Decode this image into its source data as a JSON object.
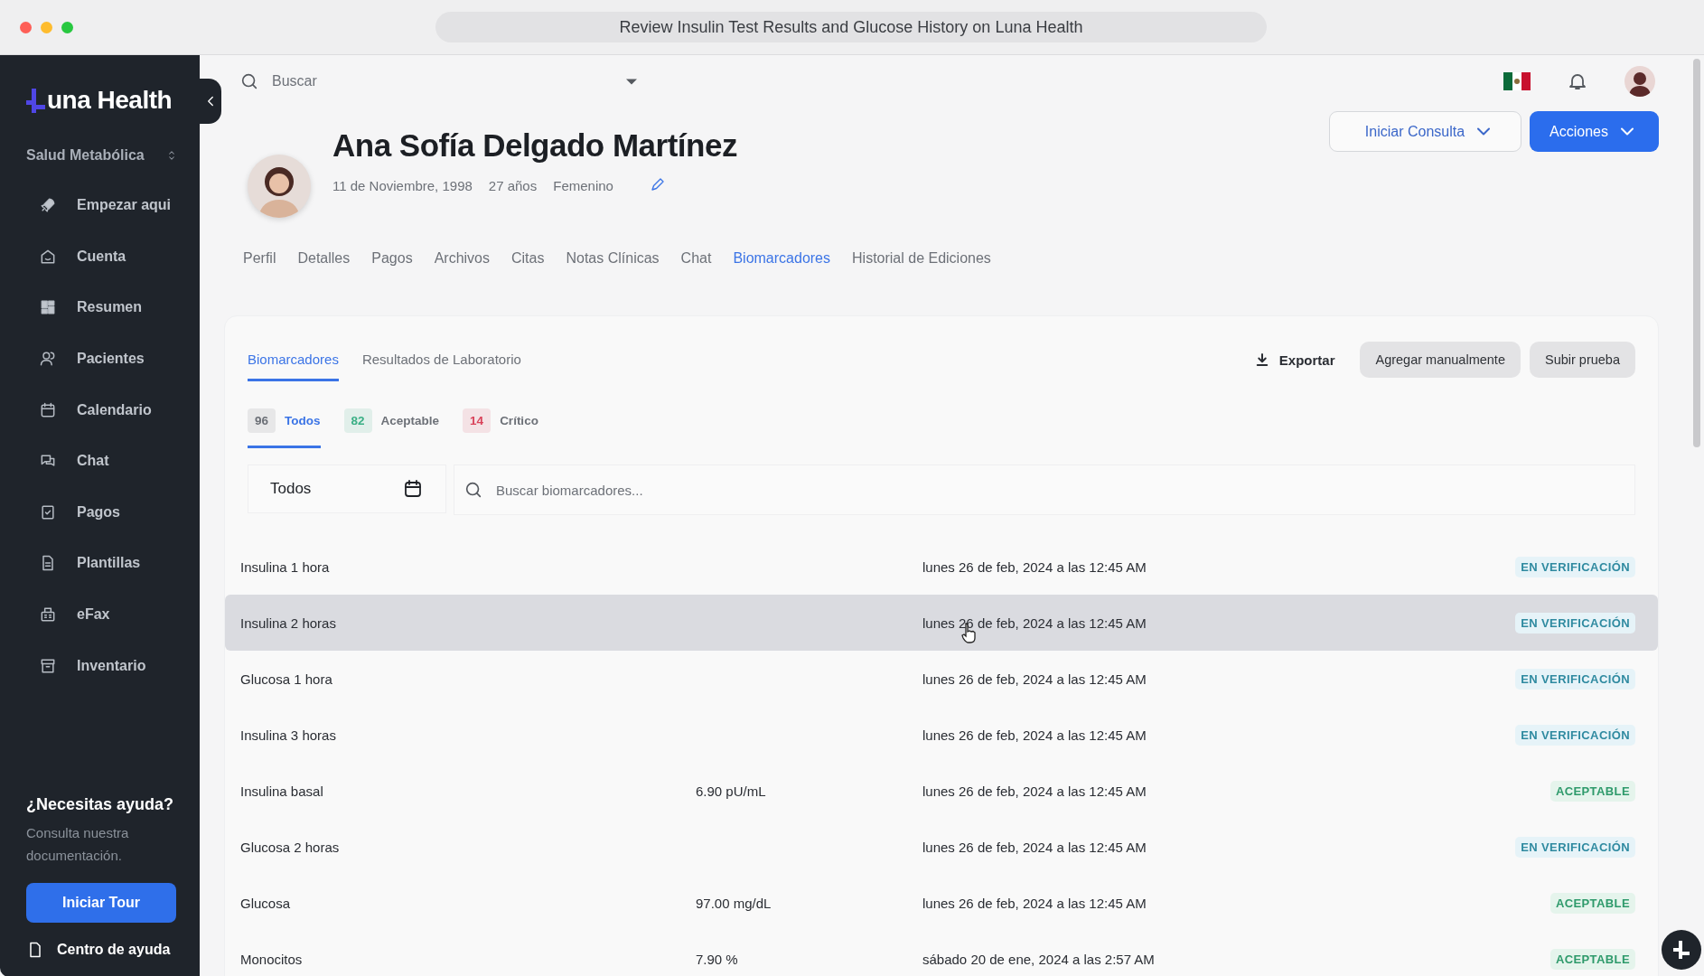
{
  "window": {
    "title": "Review Insulin Test Results and Glucose History on Luna Health"
  },
  "sidebar": {
    "brand": "una Health",
    "workspace": "Salud Metabólica",
    "items": [
      {
        "label": "Empezar aqui",
        "kind": "rocket"
      },
      {
        "label": "Cuenta",
        "kind": "home"
      },
      {
        "label": "Resumen",
        "kind": "grid"
      },
      {
        "label": "Pacientes",
        "kind": "people"
      },
      {
        "label": "Calendario",
        "kind": "calendar"
      },
      {
        "label": "Chat",
        "kind": "chat"
      },
      {
        "label": "Pagos",
        "kind": "receipt"
      },
      {
        "label": "Plantillas",
        "kind": "document"
      },
      {
        "label": "eFax",
        "kind": "fax"
      },
      {
        "label": "Inventario",
        "kind": "archive"
      }
    ],
    "help": {
      "title": "¿Necesitas ayuda?",
      "text": "Consulta nuestra documentación.",
      "button": "Iniciar Tour",
      "link": "Centro de ayuda"
    }
  },
  "header": {
    "search_placeholder": "Buscar"
  },
  "patient": {
    "name": "Ana Sofía Delgado Martínez",
    "birthdate": "11 de Noviembre, 1998",
    "age": "27 años",
    "sex": "Femenino"
  },
  "actions": [
    {
      "label": "Iniciar Consulta",
      "kind": "outline"
    },
    {
      "label": "Acciones",
      "kind": "primary"
    }
  ],
  "tabs": [
    {
      "label": "Perfil",
      "selected": false
    },
    {
      "label": "Detalles",
      "selected": false
    },
    {
      "label": "Pagos",
      "selected": false
    },
    {
      "label": "Archivos",
      "selected": false
    },
    {
      "label": "Citas",
      "selected": false
    },
    {
      "label": "Notas Clínicas",
      "selected": false
    },
    {
      "label": "Chat",
      "selected": false
    },
    {
      "label": "Biomarcadores",
      "selected": true
    },
    {
      "label": "Historial de Ediciones",
      "selected": false
    }
  ],
  "panel": {
    "tabs": [
      {
        "label": "Biomarcadores",
        "selected": true
      },
      {
        "label": "Resultados de Laboratorio",
        "selected": false
      }
    ],
    "export": "Exportar",
    "buttons": [
      "Agregar manualmente",
      "Subir prueba"
    ],
    "filters": [
      {
        "count": "96",
        "label": "Todos",
        "selected": true,
        "color": "#6b6f76"
      },
      {
        "count": "82",
        "label": "Aceptable",
        "selected": false,
        "color": "#3aaf85"
      },
      {
        "count": "14",
        "label": "Crítico",
        "selected": false,
        "color": "#d9435a"
      }
    ],
    "period": "Todos",
    "search_placeholder": "Buscar biomarcadores...",
    "rows": [
      {
        "name": "Insulina 1 hora",
        "date": "lunes 26 de feb, 2024 a las 12:45 AM",
        "status": {
          "label": "EN VERIFICACIÓN",
          "kind": "verification"
        },
        "highlighted": false
      },
      {
        "name": "Insulina 2 horas",
        "date": "lunes 26 de feb, 2024 a las 12:45 AM",
        "status": {
          "label": "EN VERIFICACIÓN",
          "kind": "verification"
        },
        "highlighted": true
      },
      {
        "name": "Glucosa 1 hora",
        "date": "lunes 26 de feb, 2024 a las 12:45 AM",
        "status": {
          "label": "EN VERIFICACIÓN",
          "kind": "verification"
        },
        "highlighted": false
      },
      {
        "name": "Insulina 3 horas",
        "date": "lunes 26 de feb, 2024 a las 12:45 AM",
        "status": {
          "label": "EN VERIFICACIÓN",
          "kind": "verification"
        },
        "highlighted": false
      },
      {
        "name": "Insulina basal",
        "value": "6.90 pU/mL",
        "date": "lunes 26 de feb, 2024 a las 12:45 AM",
        "status": {
          "label": "ACEPTABLE",
          "kind": "acceptable"
        },
        "highlighted": false
      },
      {
        "name": "Glucosa 2 horas",
        "date": "lunes 26 de feb, 2024 a las 12:45 AM",
        "status": {
          "label": "EN VERIFICACIÓN",
          "kind": "verification"
        },
        "highlighted": false
      },
      {
        "name": "Glucosa",
        "value": "97.00 mg/dL",
        "date": "lunes 26 de feb, 2024 a las 12:45 AM",
        "status": {
          "label": "ACEPTABLE",
          "kind": "acceptable"
        },
        "highlighted": false
      },
      {
        "name": "Monocitos",
        "value": "7.90 %",
        "date": "sábado 20 de ene, 2024 a las 2:57 AM",
        "status": {
          "label": "ACEPTABLE",
          "kind": "acceptable"
        },
        "highlighted": false
      }
    ]
  }
}
